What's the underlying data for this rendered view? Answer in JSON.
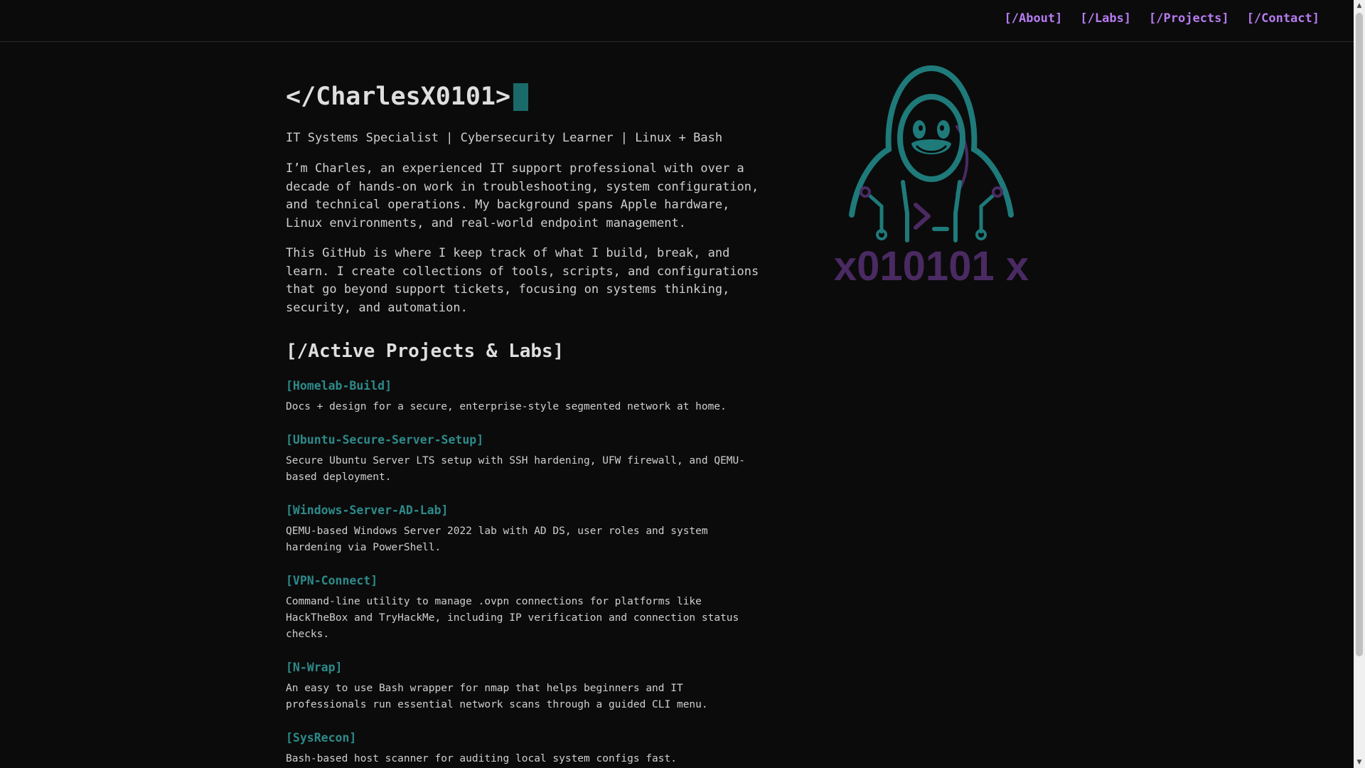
{
  "nav": {
    "items": [
      {
        "label": "[/About]"
      },
      {
        "label": "[/Labs]"
      },
      {
        "label": "[/Projects]"
      },
      {
        "label": "[/Contact]"
      }
    ]
  },
  "hero": {
    "title": "</CharlesX0101>",
    "tagline": "IT Systems Specialist | Cybersecurity Learner | Linux + Bash"
  },
  "about": {
    "paragraphs": [
      "I’m Charles, an experienced IT support professional with over a decade of hands-on work in troubleshooting, system configuration, and technical operations. My background spans Apple hardware, Linux environments, and real-world endpoint management.",
      "This GitHub is where I keep track of what I build, break, and learn. I create collections of tools, scripts, and configurations that go beyond support tickets, focusing on systems thinking, security, and automation."
    ]
  },
  "projects": {
    "heading": "[/Active Projects & Labs]",
    "items": [
      {
        "title": "[Homelab-Build]",
        "desc": "Docs + design for a secure, enterprise-style segmented network at home."
      },
      {
        "title": "[Ubuntu-Secure-Server-Setup]",
        "desc": "Secure Ubuntu Server LTS setup with SSH hardening, UFW firewall, and QEMU-based deployment."
      },
      {
        "title": "[Windows-Server-AD-Lab]",
        "desc": "QEMU-based Windows Server 2022 lab with AD DS, user roles and system hardening via PowerShell."
      },
      {
        "title": "[VPN-Connect]",
        "desc": "Command-line utility to manage .ovpn connections for platforms like HackTheBox and TryHackMe, including IP verification and connection status checks."
      },
      {
        "title": "[N-Wrap]",
        "desc": "An easy to use Bash wrapper for nmap that helps beginners and IT professionals run essential network scans through a guided CLI menu."
      },
      {
        "title": "[SysRecon]",
        "desc": "Bash-based host scanner for auditing local system configs fast."
      }
    ]
  },
  "logo": {
    "icon": "hooded-penguin-icon",
    "text": "x010101 x"
  },
  "colors": {
    "background": "#0b0b0b",
    "nav_link": "#b57bf0",
    "project_link": "#2e8a8a",
    "cursor": "#1b6a6a",
    "logo_teal": "#1f7a7a",
    "logo_purple": "#4a2a62"
  }
}
